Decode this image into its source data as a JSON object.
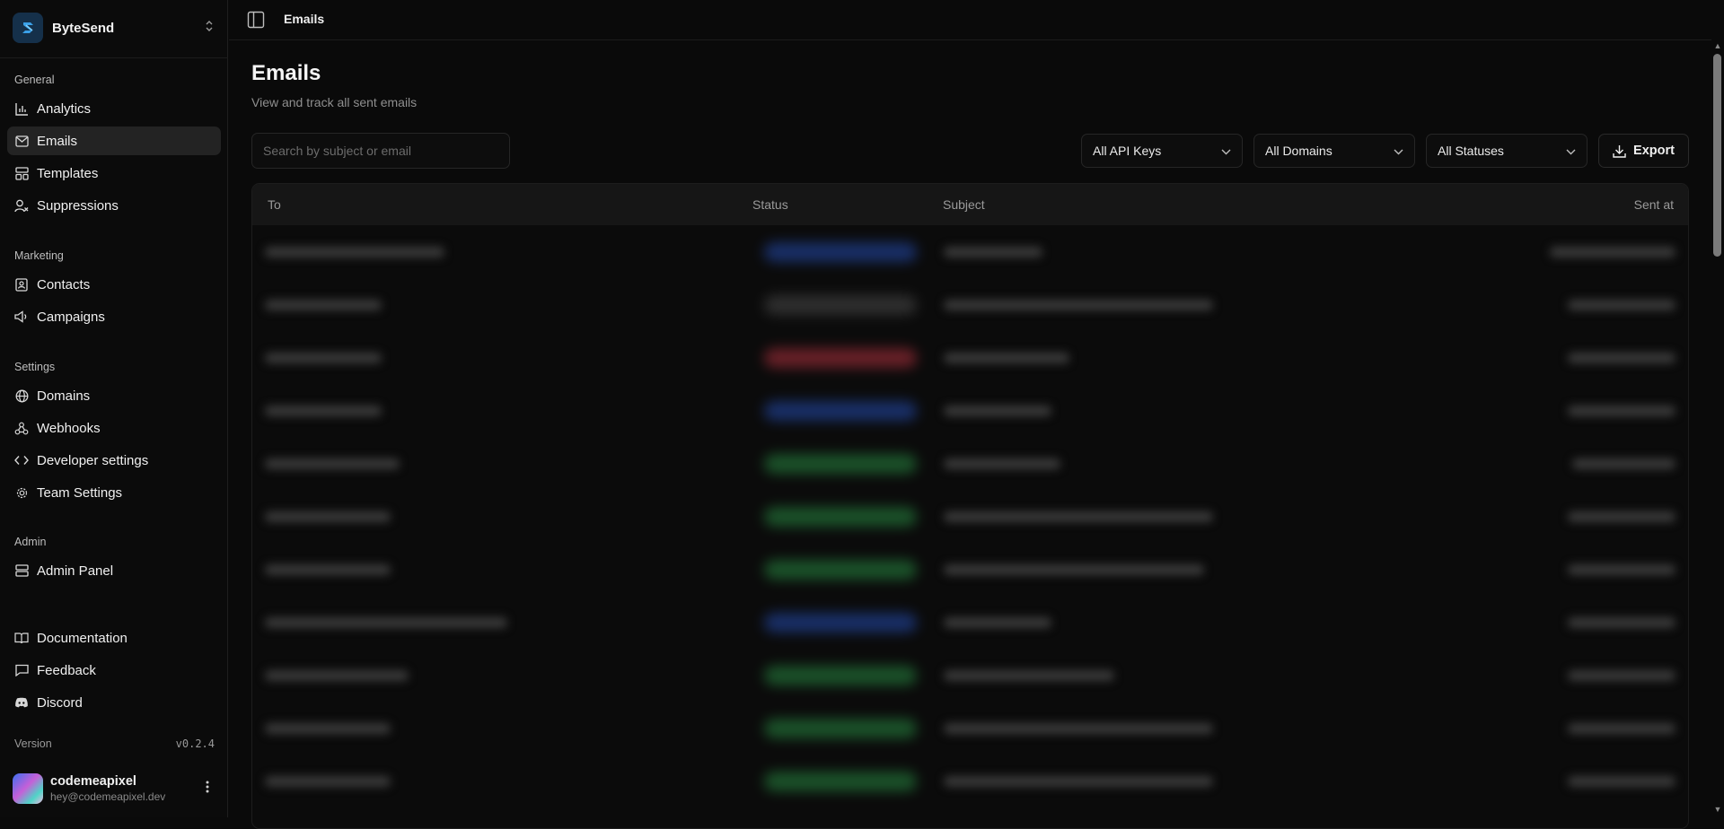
{
  "app": {
    "name": "ByteSend"
  },
  "sidebar": {
    "sections": [
      {
        "label": "General",
        "items": [
          {
            "label": "Analytics",
            "icon": "bar-chart-icon"
          },
          {
            "label": "Emails",
            "icon": "mail-icon",
            "active": true
          },
          {
            "label": "Templates",
            "icon": "layout-template-icon"
          },
          {
            "label": "Suppressions",
            "icon": "user-x-icon"
          }
        ]
      },
      {
        "label": "Marketing",
        "items": [
          {
            "label": "Contacts",
            "icon": "contact-book-icon"
          },
          {
            "label": "Campaigns",
            "icon": "megaphone-icon"
          }
        ]
      },
      {
        "label": "Settings",
        "items": [
          {
            "label": "Domains",
            "icon": "globe-icon"
          },
          {
            "label": "Webhooks",
            "icon": "webhook-icon"
          },
          {
            "label": "Developer settings",
            "icon": "code-icon"
          },
          {
            "label": "Team Settings",
            "icon": "cog-icon"
          }
        ]
      },
      {
        "label": "Admin",
        "items": [
          {
            "label": "Admin Panel",
            "icon": "server-icon"
          }
        ]
      }
    ],
    "footer_links": [
      {
        "label": "Documentation",
        "icon": "book-open-icon"
      },
      {
        "label": "Feedback",
        "icon": "message-square-icon"
      },
      {
        "label": "Discord",
        "icon": "discord-icon"
      }
    ],
    "version_label": "Version",
    "version": "v0.2.4",
    "user": {
      "name": "codemeapixel",
      "email": "hey@codemeapixel.dev"
    }
  },
  "topbar": {
    "title": "Emails"
  },
  "page": {
    "title": "Emails",
    "subtitle": "View and track all sent emails",
    "search_placeholder": "Search by subject or email",
    "filters": {
      "api_keys": "All API Keys",
      "domains": "All Domains",
      "statuses": "All Statuses"
    },
    "export_label": "Export"
  },
  "table": {
    "columns": {
      "to": "To",
      "status": "Status",
      "subject": "Subject",
      "sent_at": "Sent at"
    },
    "rows_note_blurred": true,
    "rows": [
      {
        "status_color": "#2a5bd7"
      },
      {
        "status_color": "#5a5a5a"
      },
      {
        "status_color": "#d73a4a"
      },
      {
        "status_color": "#2a5bd7"
      },
      {
        "status_color": "#2fa84f"
      },
      {
        "status_color": "#2fa84f"
      },
      {
        "status_color": "#2fa84f"
      },
      {
        "status_color": "#2a5bd7"
      },
      {
        "status_color": "#2fa84f"
      },
      {
        "status_color": "#2fa84f"
      },
      {
        "status_color": "#2fa84f"
      }
    ]
  },
  "colors": {
    "background": "#0a0a0a",
    "active_item": "#232323",
    "brand_tile": "#15304a"
  }
}
